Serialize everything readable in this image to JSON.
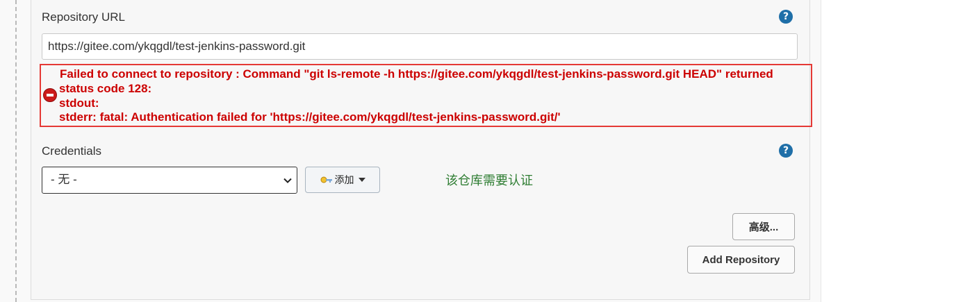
{
  "repository": {
    "url_label": "Repository URL",
    "help_symbol": "?",
    "url_value": "https://gitee.com/ykqgdl/test-jenkins-password.git"
  },
  "error": {
    "line1": "Failed to connect to repository : Command \"git ls-remote -h https://gitee.com/ykqgdl/test-jenkins-password.git HEAD\" returned",
    "line2": "status code 128:",
    "line3": "stdout:",
    "line4": "stderr: fatal: Authentication failed for 'https://gitee.com/ykqgdl/test-jenkins-password.git/'",
    "icon": "error-circle-icon",
    "highlight_color": "#e53935"
  },
  "credentials": {
    "label": "Credentials",
    "help_symbol": "?",
    "selected": "- 无 -",
    "add_label": "添加",
    "note": "该仓库需要认证"
  },
  "buttons": {
    "advanced": "高级...",
    "add_repository": "Add Repository"
  }
}
